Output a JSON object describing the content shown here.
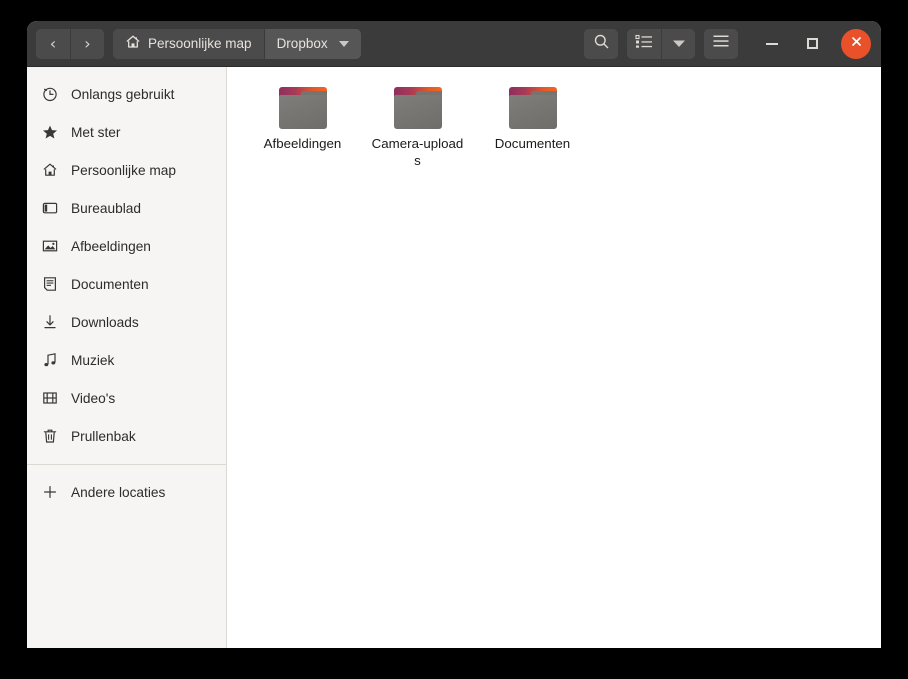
{
  "window": {
    "titlebar": {
      "nav": [
        {
          "name": "back",
          "glyph": "‹",
          "tooltip": "Terug"
        },
        {
          "name": "forward",
          "glyph": "›",
          "tooltip": "Vooruit"
        }
      ],
      "breadcrumbs": [
        {
          "label": "Persoonlijke map",
          "icon": "home-icon",
          "active": false,
          "has_caret": false
        },
        {
          "label": "Dropbox",
          "icon": "",
          "active": true,
          "has_caret": true
        }
      ],
      "actions": [
        {
          "name": "search-icon",
          "label": "Zoeken"
        },
        {
          "name": "view-list-icon",
          "label": "Weergave"
        },
        {
          "name": "view-options-caret-icon",
          "label": "Weergaveopties"
        },
        {
          "name": "hamburger-menu-icon",
          "label": "Menu"
        }
      ],
      "window_controls": [
        {
          "name": "minimize",
          "label": "Minimaliseren"
        },
        {
          "name": "maximize",
          "label": "Maximaliseren"
        },
        {
          "name": "close",
          "label": "Sluiten",
          "color": "#e8512a"
        }
      ]
    },
    "sidebar": {
      "items": [
        {
          "label": "Onlangs gebruikt",
          "icon": "clock-icon"
        },
        {
          "label": "Met ster",
          "icon": "star-icon"
        },
        {
          "label": "Persoonlijke map",
          "icon": "home-icon"
        },
        {
          "label": "Bureaublad",
          "icon": "desktop-icon"
        },
        {
          "label": "Afbeeldingen",
          "icon": "image-icon"
        },
        {
          "label": "Documenten",
          "icon": "document-icon"
        },
        {
          "label": "Downloads",
          "icon": "download-icon"
        },
        {
          "label": "Muziek",
          "icon": "music-note-icon"
        },
        {
          "label": "Video's",
          "icon": "film-icon"
        },
        {
          "label": "Prullenbak",
          "icon": "trash-icon"
        }
      ],
      "footer": [
        {
          "label": "Andere locaties",
          "icon": "plus-icon"
        }
      ]
    },
    "content": {
      "items": [
        {
          "label": "Afbeeldingen",
          "type": "folder"
        },
        {
          "label": "Camera-uploads",
          "type": "folder"
        },
        {
          "label": "Documenten",
          "type": "folder"
        }
      ]
    },
    "colors": {
      "headerbar": "#3b3b3b",
      "sidebar": "#f6f5f4",
      "content": "#ffffff",
      "close_button": "#e8512a",
      "folder_tab_start": "#8e2f5e",
      "folder_tab_end": "#f26522",
      "folder_body": "#787673"
    }
  }
}
